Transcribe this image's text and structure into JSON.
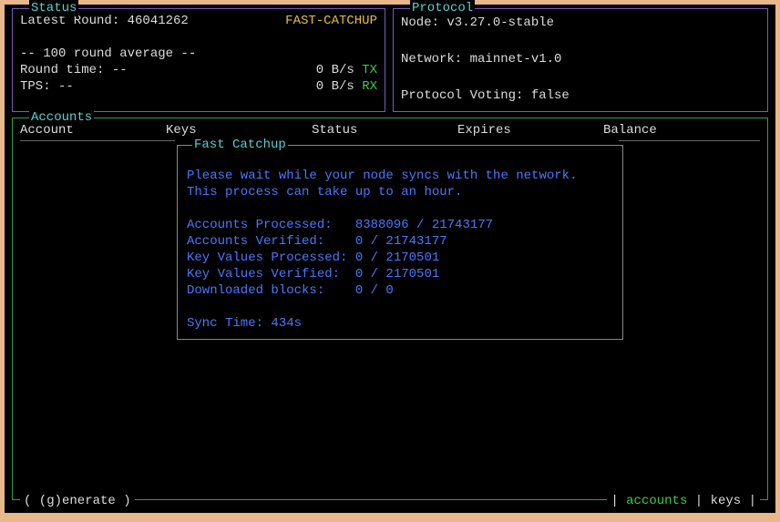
{
  "status": {
    "legend": "Status",
    "latest_label": "Latest Round: ",
    "latest_value": "46041262",
    "mode": "FAST-CATCHUP",
    "avg_label": "-- 100 round average --",
    "round_time_label": "Round time: --",
    "tps_label": "TPS: --",
    "tx_rate": "0 B/s ",
    "tx": "TX",
    "rx_rate": "0 B/s ",
    "rx": "RX"
  },
  "protocol": {
    "legend": "Protocol",
    "node": "Node: v3.27.0-stable",
    "network": "Network: mainnet-v1.0",
    "voting": "Protocol Voting: false"
  },
  "accounts": {
    "legend": "Accounts",
    "cols": {
      "c1": "Account",
      "c2": "Keys",
      "c3": "Status",
      "c4": "Expires",
      "c5": "Balance"
    }
  },
  "catchup": {
    "legend": "Fast Catchup",
    "msg1": "Please wait while your node syncs with the network.",
    "msg2": "This process can take up to an hour.",
    "l1": "Accounts Processed:   8388096 / 21743177",
    "l2": "Accounts Verified:    0 / 21743177",
    "l3": "Key Values Processed: 0 / 2170501",
    "l4": "Key Values Verified:  0 / 2170501",
    "l5": "Downloaded blocks:    0 / 0",
    "sync": "Sync Time: 434s"
  },
  "footer": {
    "generate": "( (g)enerate )",
    "sep": " | ",
    "tab1": "accounts",
    "tab2": "keys"
  }
}
